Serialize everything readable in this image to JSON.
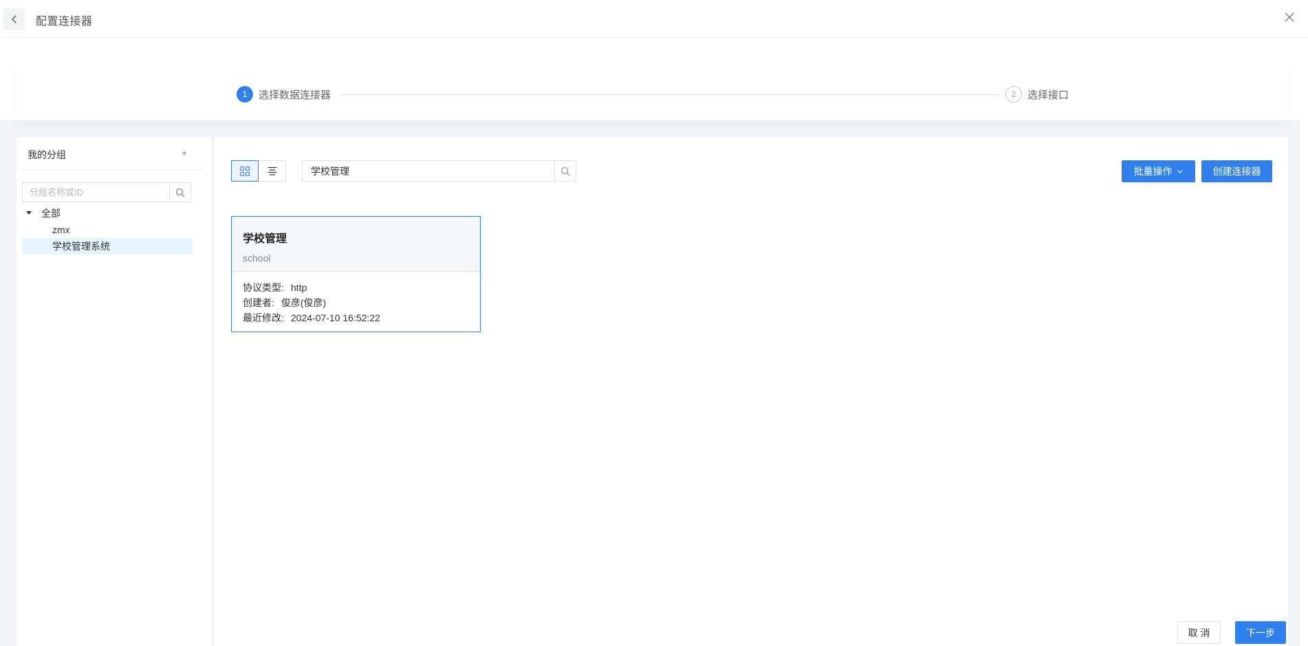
{
  "header": {
    "title": "配置连接器"
  },
  "steps": [
    {
      "number": "1",
      "label": "选择数据连接器",
      "status": "active"
    },
    {
      "number": "2",
      "label": "选择接口",
      "status": "inactive"
    }
  ],
  "groups": {
    "title": "我的分组",
    "add_label": "+",
    "search_placeholder": "分组名称或ID",
    "tree": [
      {
        "label": "全部",
        "expanded": true
      },
      {
        "label": "zmx"
      },
      {
        "label": "学校管理系统",
        "selected": true
      }
    ]
  },
  "toolbar": {
    "search_value": "学校管理",
    "batch_label": "批量操作",
    "create_label": "创建连接器"
  },
  "connectors": [
    {
      "name": "学校管理",
      "code": "school",
      "protocol_label": "协议类型:",
      "protocol": "http",
      "creator_label": "创建者:",
      "creator": "俊彦(俊彦)",
      "modified_label": "最近修改:",
      "modified": "2024-07-10 16:52:22"
    }
  ],
  "footer": {
    "cancel_label": "取 消",
    "next_label": "下一步"
  },
  "colors": {
    "primary": "#2f80ed",
    "selected_row": "#e6f4fd"
  }
}
